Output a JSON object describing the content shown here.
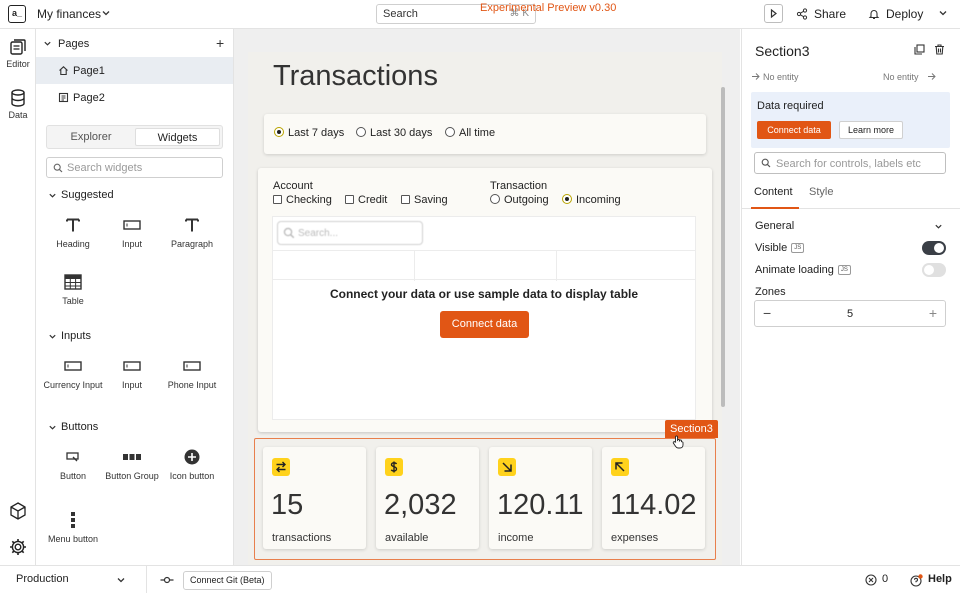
{
  "topbar": {
    "app_logo": "a_",
    "app_name": "My finances",
    "search_placeholder": "Search",
    "search_shortcut": "⌘ K",
    "preview_label": "Experimental Preview v0.30",
    "share_label": "Share",
    "deploy_label": "Deploy"
  },
  "rail": {
    "editor_label": "Editor",
    "data_label": "Data"
  },
  "explorer": {
    "pages_title": "Pages",
    "pages": [
      {
        "label": "Page1",
        "selected": true
      },
      {
        "label": "Page2",
        "selected": false
      }
    ],
    "tabs": [
      "Explorer",
      "Widgets"
    ],
    "active_tab": "Widgets",
    "widget_search_placeholder": "Search widgets",
    "sections": [
      {
        "title": "Suggested",
        "widgets": [
          {
            "label": "Heading",
            "icon": "heading-icon"
          },
          {
            "label": "Input",
            "icon": "input-icon"
          },
          {
            "label": "Paragraph",
            "icon": "paragraph-icon"
          },
          {
            "label": "Table",
            "icon": "table-icon"
          }
        ]
      },
      {
        "title": "Inputs",
        "widgets": [
          {
            "label": "Currency Input",
            "icon": "currency-input-icon"
          },
          {
            "label": "Input",
            "icon": "input-icon"
          },
          {
            "label": "Phone Input",
            "icon": "phone-input-icon"
          }
        ]
      },
      {
        "title": "Buttons",
        "widgets": [
          {
            "label": "Button",
            "icon": "button-icon"
          },
          {
            "label": "Button Group",
            "icon": "button-group-icon"
          },
          {
            "label": "Icon button",
            "icon": "icon-button-icon"
          },
          {
            "label": "Menu button",
            "icon": "menu-button-icon"
          }
        ]
      }
    ]
  },
  "canvas": {
    "page_title": "Transactions",
    "range_options": [
      {
        "label": "Last 7 days",
        "selected": true
      },
      {
        "label": "Last 30 days",
        "selected": false
      },
      {
        "label": "All time",
        "selected": false
      }
    ],
    "account_label": "Account",
    "account_options": [
      "Checking",
      "Credit",
      "Saving"
    ],
    "transaction_label": "Transaction",
    "transaction_options": [
      {
        "label": "Outgoing",
        "selected": false
      },
      {
        "label": "Incoming",
        "selected": true
      }
    ],
    "table_search_placeholder": "Search...",
    "table_message": "Connect your data or use sample data to display table",
    "table_connect_label": "Connect data",
    "section_tag": "Section3",
    "stats": [
      {
        "value": "15",
        "label": "transactions",
        "icon": "swap-arrows-icon"
      },
      {
        "value": "2,032",
        "label": "available",
        "icon": "dollar-icon"
      },
      {
        "value": "120.11",
        "label": "income",
        "icon": "arrow-down-right-icon"
      },
      {
        "value": "114.02",
        "label": "expenses",
        "icon": "arrow-up-left-icon"
      }
    ],
    "accent_color": "#e15615",
    "stat_icon_color": "#ffd21c"
  },
  "props": {
    "title": "Section3",
    "entity_left": "No entity",
    "entity_right": "No entity",
    "data_required_title": "Data required",
    "connect_label": "Connect data",
    "learn_label": "Learn more",
    "search_placeholder": "Search for controls, labels etc",
    "tabs": [
      "Content",
      "Style"
    ],
    "active_tab": "Content",
    "general_label": "General",
    "visible_label": "Visible",
    "visible_on": true,
    "animate_label": "Animate loading",
    "animate_on": false,
    "zones_label": "Zones",
    "zones_value": "5",
    "js_badge": "JS"
  },
  "bottombar": {
    "environment": "Production",
    "git_label": "Connect Git (Beta)",
    "error_count": "0",
    "help_label": "Help"
  }
}
